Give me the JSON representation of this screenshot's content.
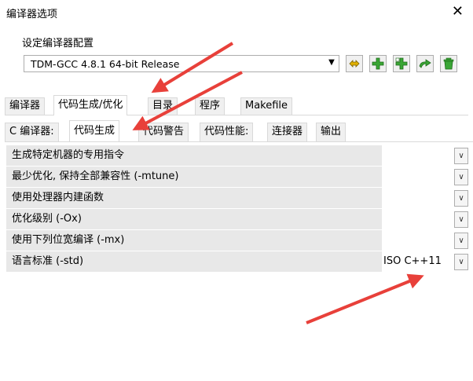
{
  "window": {
    "title": "编译器选项",
    "close_glyph": "✕"
  },
  "config": {
    "group_label": "设定编译器配置",
    "selected": "TDM-GCC 4.8.1 64-bit Release",
    "toolbar_icons": [
      "rename-icon",
      "add-icon",
      "copy-icon",
      "export-icon",
      "delete-icon"
    ]
  },
  "tabs_main": [
    "编译器",
    "代码生成/优化",
    "目录",
    "程序",
    "Makefile"
  ],
  "tabs_sub": [
    "C 编译器:",
    "代码生成",
    "代码警告",
    "代码性能:",
    "连接器",
    "输出"
  ],
  "options": [
    {
      "label": "生成特定机器的专用指令",
      "value": ""
    },
    {
      "label": "最少优化, 保持全部兼容性 (-mtune)",
      "value": ""
    },
    {
      "label": "使用处理器内建函数",
      "value": ""
    },
    {
      "label": "优化级别 (-Ox)",
      "value": ""
    },
    {
      "label": "使用下列位宽编译 (-mx)",
      "value": ""
    },
    {
      "label": "语言标准 (-std)",
      "value": "ISO C++11"
    }
  ],
  "colors": {
    "arrow": "#e8403a",
    "green_icon": "#3aa635",
    "yellow_icon": "#e0b000"
  }
}
